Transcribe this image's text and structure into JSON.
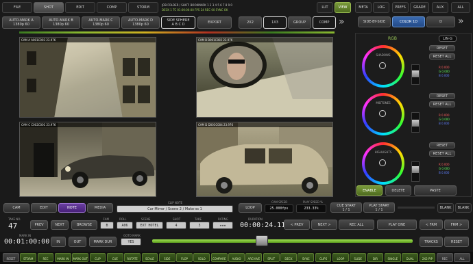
{
  "top_tabs": [
    "FILE",
    "SHOT",
    "EDIT",
    "COMP",
    "STORM"
  ],
  "top_tabs_active": "SHOT",
  "status_line1": "JOB FOLDER / SHOT: BOOKMARK 1 2 3 4 5 6 7 8 9 0",
  "status_line2": "DECK 1 TC 01:00:00:00  FPS 24  REC 00  SYNC OK",
  "right_tabs": [
    "LUT",
    "VIEW",
    "META",
    "LOG",
    "PREFS",
    "GRADE",
    "AUX",
    "ALL"
  ],
  "mode_buttons": [
    {
      "line1": "AUTO-MARK A",
      "line2": "1380p 60"
    },
    {
      "line1": "AUTO-MARK B",
      "line2": "1380p 60"
    },
    {
      "line1": "AUTO-MARK C",
      "line2": "1380p 60"
    },
    {
      "line1": "AUTO-MARK D",
      "line2": "1380p 60"
    }
  ],
  "single_view": {
    "line1": "SIDE SPHERE",
    "line2": "A  B  C  D"
  },
  "export_label": "EXPORT",
  "layout_buttons": [
    "2X2",
    "1X3",
    "GROUP",
    "COMP"
  ],
  "grade_tabs": [
    "SIDE-BY-SIDE",
    "COLOR 1D",
    "D"
  ],
  "grade_header": "RGB",
  "grade_pill": "LIN-G",
  "grade_wheels": [
    {
      "name": "SHADOWS",
      "btn1": "RESET",
      "btn2": "RESET ALL",
      "rgb": [
        "R 0.000",
        "G 0.000",
        "B 0.000"
      ]
    },
    {
      "name": "MIDTONES",
      "btn1": "RESET",
      "btn2": "RESET ALL",
      "rgb": [
        "R 0.000",
        "G 0.000",
        "B 0.000"
      ]
    },
    {
      "name": "HIGHLIGHTS",
      "btn1": "RESET",
      "btn2": "RESET ALL",
      "rgb": [
        "R 0.000",
        "G 0.000",
        "B 0.000"
      ]
    }
  ],
  "grade_bottom": [
    "ENABLE",
    "DELETE",
    "PASTE"
  ],
  "viewport_labels": [
    "CAM A  A001C003  23.976",
    "CAM B  B001C002  23.976",
    "CAM C  C002C001  23.976",
    "CAM D  D001C004  23.976"
  ],
  "source_tabs": [
    "CAM",
    "EDIT",
    "NOTE",
    "MEDIA"
  ],
  "source_active": "NOTE",
  "clip_name_label": "CLIP NOTE",
  "clip_name": "Car Mirror / Scene 2 / Make-ss 1",
  "loop_label": "LOOP",
  "cam_speed_label": "CAM SPEED",
  "cam_speed": "25.000fps",
  "play_speed_label": "PLAY SPEED %",
  "play_speed": "233.33%",
  "cue_buttons": [
    "CUE START",
    "PLAY START"
  ],
  "cue_vals": [
    "1 / 1",
    "1 / 1"
  ],
  "blank_btn": "BLANK",
  "take_label": "TAKE NO.",
  "take_value": "47",
  "nav_buttons": [
    "PREV",
    "NEXT",
    "BROWSE"
  ],
  "fields": [
    {
      "label": "CAM",
      "value": "B"
    },
    {
      "label": "ROLL",
      "value": "A06"
    },
    {
      "label": "SCENE",
      "value": "EXT HOTEL"
    },
    {
      "label": "SHOT",
      "value": "4"
    },
    {
      "label": "TAKE",
      "value": "3"
    },
    {
      "label": "RATING",
      "value": "★★★"
    }
  ],
  "duration_label": "DURATION",
  "duration": "00:00:24.11",
  "transport": [
    "< PREV",
    "NEXT >",
    "REC ALL",
    "PLAY ONE",
    "< FRM",
    "FRM >"
  ],
  "tc_label": "MARK IN",
  "timecode": "00:01:00:00",
  "in_btn": "IN",
  "out_btn": "OUT",
  "mark_btn": "MARK DUR",
  "mark_val_label": "GOTO MARK",
  "mark_val": "YES",
  "scrub_position": 0.42,
  "goto_btn": "TRACKS",
  "reset_btn": "RESET",
  "bottom_keys": [
    "RESET",
    "STORM",
    "REC",
    "MARK IN",
    "MARK OUT",
    "CLIP",
    "CUE",
    "ROTATE",
    "SCALE",
    "SIDE",
    "FLOP",
    "SOLO",
    "COMPARE",
    "AUDIO",
    "ARCHIVE",
    "SPLIT",
    "DECK",
    "SYNC",
    "CLIPS",
    "LOOP",
    "SLIDE",
    "DIR",
    "SINGLE",
    "DUAL",
    "2X2 PIP",
    "REC",
    "ALL"
  ],
  "accent_green": "#8bc34a",
  "accent_purple": "#7a44c0"
}
